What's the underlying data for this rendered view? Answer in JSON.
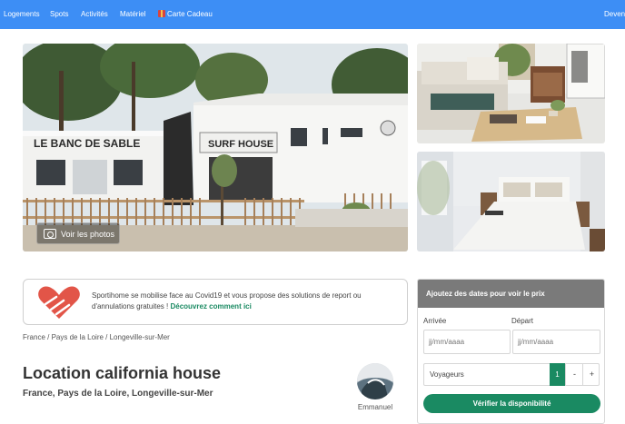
{
  "nav": {
    "items": [
      {
        "label": "Logements"
      },
      {
        "label": "Spots"
      },
      {
        "label": "Activités"
      },
      {
        "label": "Matériel"
      },
      {
        "label": "Carte Cadeau"
      }
    ],
    "right_label": "Devenir"
  },
  "gallery": {
    "main_sign_left": "LE BANC DE SABLE",
    "main_sign_right": "SURF HOUSE",
    "voir_photos": "Voir les photos"
  },
  "covid": {
    "text": "Sportihome se mobilise face au Covid19 et vous propose des solutions de report ou d'annulations gratuites ! ",
    "link": "Découvrez comment ici"
  },
  "breadcrumb": "France / Pays de la Loire / Longeville-sur-Mer",
  "listing": {
    "title": "Location california house",
    "location": "France, Pays de la Loire, Longeville-sur-Mer"
  },
  "host": {
    "name": "Emmanuel"
  },
  "booking": {
    "header": "Ajoutez des dates pour voir le prix",
    "arrival_label": "Arrivée",
    "departure_label": "Départ",
    "arrival_placeholder": "jj/mm/aaaa",
    "departure_placeholder": "jj/mm/aaaa",
    "travelers_label": "Voyageurs",
    "travelers_value": "1",
    "minus": "-",
    "plus": "+",
    "verify_button": "Vérifier la disponibilité"
  },
  "colors": {
    "nav_bg": "#3d8ef5",
    "accent_green": "#1a8a62",
    "booking_header": "#7a7a7a"
  }
}
